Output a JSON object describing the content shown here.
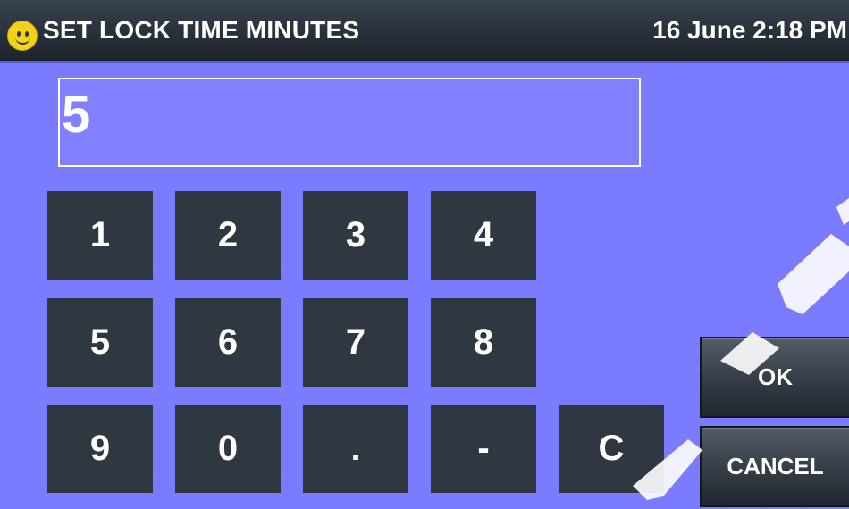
{
  "header": {
    "icon": "smiley-icon",
    "title": "SET LOCK TIME MINUTES",
    "datetime": "16 June 2:18 PM"
  },
  "display": {
    "value": "5"
  },
  "keypad": {
    "keys": [
      "1",
      "2",
      "3",
      "4",
      "5",
      "6",
      "7",
      "8",
      "9",
      "0",
      ".",
      "-",
      "C"
    ]
  },
  "actions": {
    "ok_label": "OK",
    "cancel_label": "CANCEL"
  },
  "colors": {
    "background": "#7b7bff",
    "key": "#2f3841",
    "titlebar": "#283039",
    "smiley": "#f2d21a"
  }
}
